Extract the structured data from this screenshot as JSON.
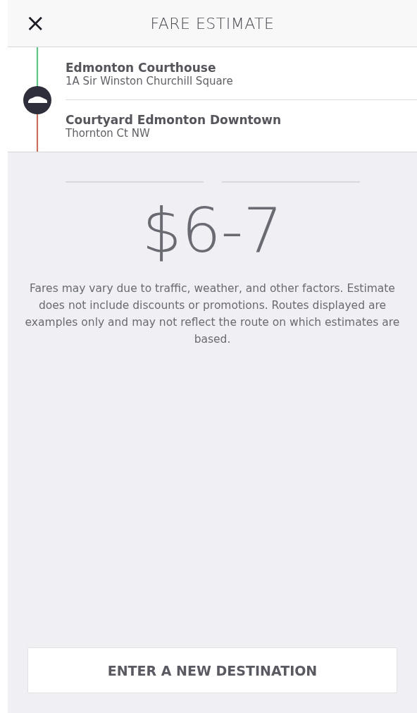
{
  "header": {
    "close": "×",
    "title": "FARE ESTIMATE"
  },
  "stops": [
    {
      "name": "Edmonton Courthouse",
      "address": "1A Sir Winston Churchill Square",
      "color": "#4cd07a"
    },
    {
      "name": "Courtyard Edmonton Downtown",
      "address": "Thornton Ct NW",
      "color": "#e0654f"
    }
  ],
  "fare": "$6-7",
  "disclaimer": "Fares may vary due to traffic, weather, and other factors. Estimate does not include discounts or promotions. Routes displayed are examples only and may not reflect the route on which estimates are based.",
  "button": "ENTER A NEW DESTINATION"
}
